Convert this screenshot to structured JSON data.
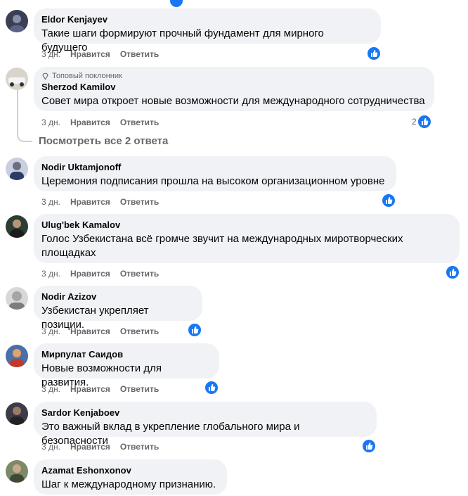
{
  "actions": {
    "time": "3 дн.",
    "like": "Нравится",
    "reply": "Ответить"
  },
  "badge_top_fan": "Топовый поклонник",
  "view_replies": "Посмотреть все 2 ответа",
  "reaction_count_2": "2",
  "colors": {
    "bubble": "#f0f2f5",
    "like_blue": "#1877f2",
    "secondary_text": "#65676b"
  },
  "comments": [
    {
      "author": "Eldor Kenjayev",
      "text": "Такие шаги формируют прочный фундамент для мирного будущего"
    },
    {
      "author": "Sherzod Kamilov",
      "text": "Совет мира откроет новые возможности для международного сотрудничества"
    },
    {
      "author": "Nodir Uktamjonoff",
      "text": "Церемония подписания прошла на высоком организационном уровне"
    },
    {
      "author": "Ulug'bek Kamalov",
      "text_line1": "Голос Узбекистана всё громче звучит на международных миротворческих",
      "text_line2": "площадках"
    },
    {
      "author": "Nodir Azizov",
      "text": "Узбекистан укрепляет позиции."
    },
    {
      "author": "Мирпулат Саидов",
      "text": "Новые возможности для развития."
    },
    {
      "author": "Sardor Kenjaboev",
      "text": "Это важный вклад в укрепление глобального мира и безопасности"
    },
    {
      "author": "Azamat Eshonxonov",
      "text": "Шаг к международному признанию."
    }
  ]
}
